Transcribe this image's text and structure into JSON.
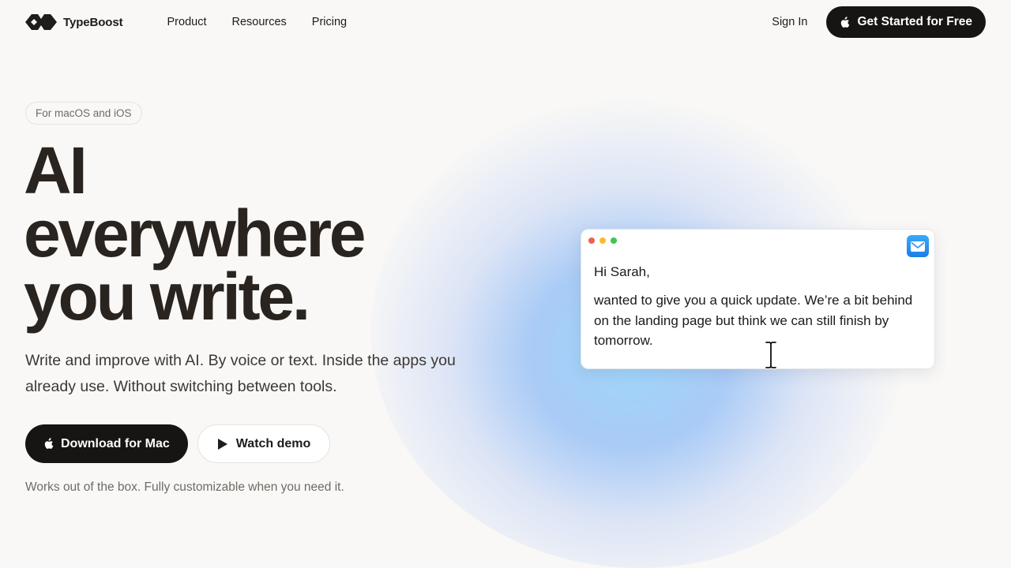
{
  "brand": {
    "name": "TypeBoost"
  },
  "nav": {
    "links": [
      "Product",
      "Resources",
      "Pricing"
    ],
    "sign_in": "Sign In",
    "cta": "Get Started for Free"
  },
  "hero": {
    "badge": "For macOS and iOS",
    "headline": [
      "AI",
      "everywhere",
      "you write."
    ],
    "subtitle": "Write and improve with AI. By voice or text. Inside the apps you already use. Without switching between tools.",
    "download_label": "Download for Mac",
    "demo_label": "Watch demo",
    "note": "Works out of the box. Fully customizable when you need it."
  },
  "mock_email": {
    "greeting": "Hi Sarah,",
    "body": "wanted to give you a quick update. We’re a bit behind on the landing page but think we can still finish by tomorrow.",
    "app_icon": "mail-icon"
  },
  "colors": {
    "background": "#f9f8f6",
    "primary_button": "#171513",
    "text": "#29241f",
    "muted_text": "#6f6a64",
    "glow": "#9fd6fb",
    "traffic_red": "#ee5f57",
    "traffic_yellow": "#f5bd30",
    "traffic_green": "#3fc84a"
  }
}
